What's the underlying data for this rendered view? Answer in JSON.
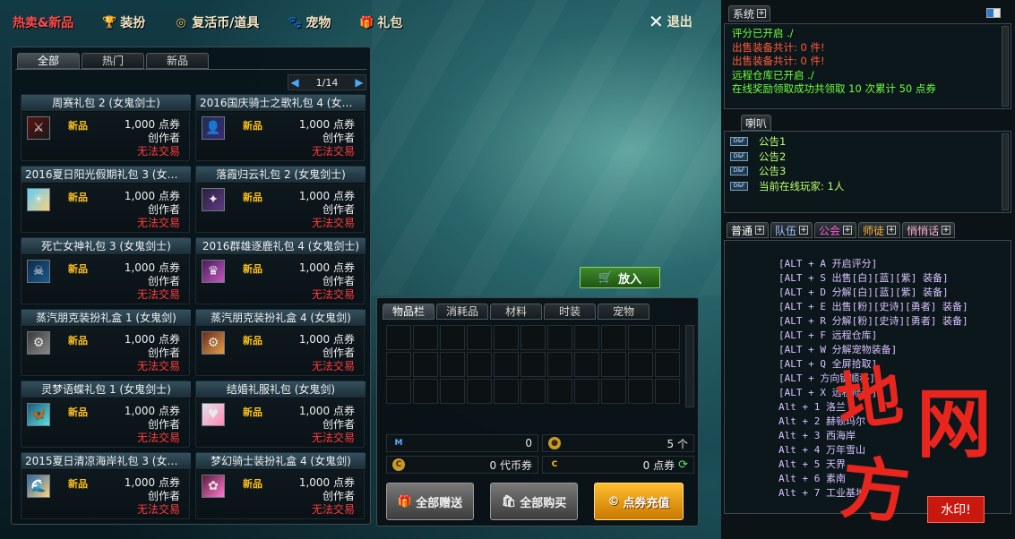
{
  "topbar": {
    "items": [
      {
        "label": "热卖&新品",
        "icon": "hot-icon"
      },
      {
        "label": "装扮",
        "icon": "trophy-icon"
      },
      {
        "label": "复活币/道具",
        "icon": "coin-icon"
      },
      {
        "label": "宠物",
        "icon": "paw-icon"
      },
      {
        "label": "礼包",
        "icon": "gift-icon"
      }
    ],
    "exit_label": "退出"
  },
  "shop": {
    "tabs": [
      "全部",
      "热门",
      "新品"
    ],
    "page": "1/14",
    "items": [
      {
        "name": "周赛礼包 2 (女鬼剑士)",
        "badge": "新品",
        "price": "1,000 点券",
        "creator": "创作者",
        "trade": "无法交易"
      },
      {
        "name": "2016国庆骑士之歌礼包 4 (女鬼...",
        "badge": "新品",
        "price": "1,000 点券",
        "creator": "创作者",
        "trade": "无法交易"
      },
      {
        "name": "2016夏日阳光假期礼包 3 (女鬼...",
        "badge": "新品",
        "price": "1,000 点券",
        "creator": "创作者",
        "trade": "无法交易"
      },
      {
        "name": "落霞归云礼包 2 (女鬼剑士)",
        "badge": "新品",
        "price": "1,000 点券",
        "creator": "创作者",
        "trade": "无法交易"
      },
      {
        "name": "死亡女神礼包 3 (女鬼剑士)",
        "badge": "新品",
        "price": "1,000 点券",
        "creator": "创作者",
        "trade": "无法交易"
      },
      {
        "name": "2016群雄逐鹿礼包 4 (女鬼剑士)",
        "badge": "新品",
        "price": "1,000 点券",
        "creator": "创作者",
        "trade": "无法交易"
      },
      {
        "name": "蒸汽朋克装扮礼盒 1 (女鬼剑)",
        "badge": "新品",
        "price": "1,000 点券",
        "creator": "创作者",
        "trade": "无法交易"
      },
      {
        "name": "蒸汽朋克装扮礼盒 4 (女鬼剑)",
        "badge": "新品",
        "price": "1,000 点券",
        "creator": "创作者",
        "trade": "无法交易"
      },
      {
        "name": "灵梦语蝶礼包 1 (女鬼剑士)",
        "badge": "新品",
        "price": "1,000 点券",
        "creator": "创作者",
        "trade": "无法交易"
      },
      {
        "name": "结婚礼服礼包 (女鬼剑)",
        "badge": "新品",
        "price": "1,000 点券",
        "creator": "创作者",
        "trade": "无法交易"
      },
      {
        "name": "2015夏日清凉海岸礼包 3 (女鬼...",
        "badge": "新品",
        "price": "1,000 点券",
        "creator": "创作者",
        "trade": "无法交易"
      },
      {
        "name": "梦幻骑士装扮礼盒 4 (女鬼剑)",
        "badge": "新品",
        "price": "1,000 点券",
        "creator": "创作者",
        "trade": "无法交易"
      }
    ]
  },
  "put_in_label": "放入",
  "inventory": {
    "tabs": [
      "物品栏",
      "消耗品",
      "材料",
      "时装",
      "宠物"
    ],
    "currency": {
      "m_value": "0",
      "count_value": "5 个",
      "voucher_value": "0 代币券",
      "point_value": "0 点券"
    },
    "buttons": {
      "gift_all": "全部赠送",
      "buy_all": "全部购买",
      "recharge": "点券充值"
    }
  },
  "system": {
    "tab_label": "系统",
    "lines": [
      {
        "text": "评分已开启 ./",
        "color": "#6cff3a"
      },
      {
        "text": "出售装备共计: 0 件!",
        "color": "#ff5a3a"
      },
      {
        "text": "出售装备共计: 0 件!",
        "color": "#ff5a3a"
      },
      {
        "text": "远程仓库已开启 ./",
        "color": "#6cff3a"
      },
      {
        "text": "在线奖励领取成功共领取 10 次累计 50 点券",
        "color": "#6cff3a"
      }
    ]
  },
  "horn": {
    "tab_label": "喇叭",
    "lines": [
      "公告1",
      "公告2",
      "公告3",
      "当前在线玩家: 1人"
    ]
  },
  "chat": {
    "tabs": [
      {
        "label": "普通",
        "color": "#ffffff"
      },
      {
        "label": "队伍",
        "color": "#9ec0ff"
      },
      {
        "label": "公会",
        "color": "#ff5ad8"
      },
      {
        "label": "师徒",
        "color": "#ffb23a"
      },
      {
        "label": "悄悄话",
        "color": "#ffb0d0"
      }
    ],
    "lines": [
      "[ALT + A   开启评分]",
      "[ALT + S   出售[白][蓝][紫] 装备]",
      "[ALT + D   分解[白][蓝][紫] 装备]",
      "[ALT + E   出售[粉][史诗][勇者] 装备]",
      "[ALT + R   分解[粉][史诗][勇者] 装备]",
      "[ALT + F   远程仓库]",
      "[ALT + W   分解宠物装备]",
      "[ALT + Q   全屏拾取]",
      "[ALT + 方向键顺移]",
      "[ALT + X 远程修理]",
      "Alt + 1   洛兰",
      "Alt + 2   赫顿玛尔",
      "Alt + 3   西海岸",
      "Alt + 4   万年雪山",
      "Alt + 5   天界",
      "Alt + 6   素南",
      "Alt + 7   工业基地"
    ]
  },
  "watermark": {
    "chars": [
      "地",
      "网",
      "方"
    ],
    "tag": "水印!"
  }
}
